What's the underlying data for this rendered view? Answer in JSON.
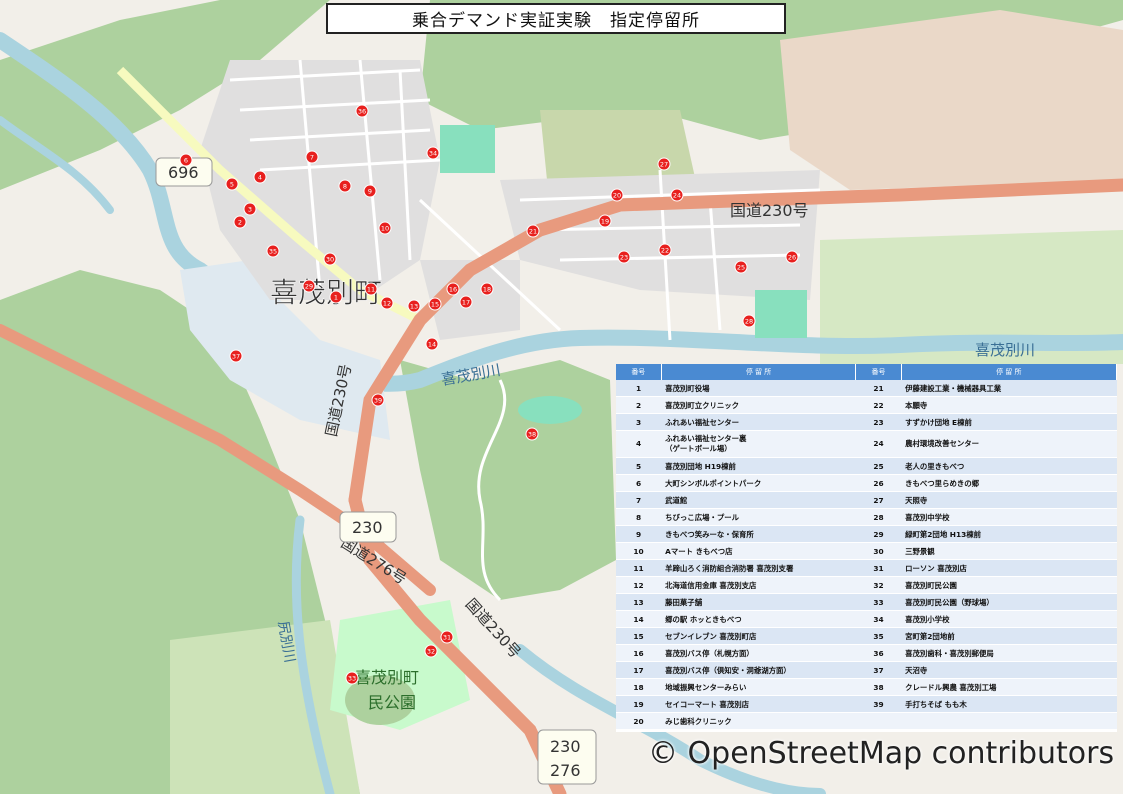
{
  "title": "乗合デマンド実証実験　指定停留所",
  "attribution": "© OpenStreetMap contributors",
  "map_labels": {
    "town": "喜茂別町",
    "route230_a": "国道230号",
    "route230_b": "国道230号",
    "route230_c": "国道230号",
    "route276": "国道276号",
    "river_a": "喜茂別川",
    "river_b": "喜茂別川",
    "river_c": "尻別川",
    "park_line1": "喜茂別町",
    "park_line2": "民公園",
    "shield_696": "696",
    "shield_230a": "230",
    "shield_230b": "230",
    "shield_276": "276"
  },
  "legend": {
    "header_no": "番号",
    "header_name": "停 留 所",
    "rows": [
      {
        "no_a": "1",
        "name_a": "喜茂別町役場",
        "no_b": "21",
        "name_b": "伊藤建設工業・機械器具工業"
      },
      {
        "no_a": "2",
        "name_a": "喜茂別町立クリニック",
        "no_b": "22",
        "name_b": "本願寺"
      },
      {
        "no_a": "3",
        "name_a": "ふれあい福祉センター",
        "no_b": "23",
        "name_b": "すずかけ団地 E棟前"
      },
      {
        "no_a": "4",
        "name_a": "ふれあい福祉センター裏\n（ゲートボール場）",
        "no_b": "24",
        "name_b": "農村環境改善センター"
      },
      {
        "no_a": "5",
        "name_a": "喜茂別団地 H19棟前",
        "no_b": "25",
        "name_b": "老人の里きもべつ"
      },
      {
        "no_a": "6",
        "name_a": "大町シンボルポイントパーク",
        "no_b": "26",
        "name_b": "きもべつ里らめきの郷"
      },
      {
        "no_a": "7",
        "name_a": "武道館",
        "no_b": "27",
        "name_b": "天照寺"
      },
      {
        "no_a": "8",
        "name_a": "ちびっこ広場・プール",
        "no_b": "28",
        "name_b": "喜茂別中学校"
      },
      {
        "no_a": "9",
        "name_a": "きもべつ笑みーな・保育所",
        "no_b": "29",
        "name_b": "緑町第2団地 H13棟前"
      },
      {
        "no_a": "10",
        "name_a": "Aマート きもべつ店",
        "no_b": "30",
        "name_b": "三野景観"
      },
      {
        "no_a": "11",
        "name_a": "羊蹄山ろく消防組合消防署 喜茂別支署",
        "no_b": "31",
        "name_b": "ローソン 喜茂別店"
      },
      {
        "no_a": "12",
        "name_a": "北海道信用金庫 喜茂別支店",
        "no_b": "32",
        "name_b": "喜茂別町民公園"
      },
      {
        "no_a": "13",
        "name_a": "藤田菓子舗",
        "no_b": "33",
        "name_b": "喜茂別町民公園（野球場）"
      },
      {
        "no_a": "14",
        "name_a": "郷の駅 ホッときもべつ",
        "no_b": "34",
        "name_b": "喜茂別小学校"
      },
      {
        "no_a": "15",
        "name_a": "セブンイレブン 喜茂別町店",
        "no_b": "35",
        "name_b": "宮町第2団地前"
      },
      {
        "no_a": "16",
        "name_a": "喜茂別バス停（札幌方面）",
        "no_b": "36",
        "name_b": "喜茂別歯科・喜茂別郵便局"
      },
      {
        "no_a": "17",
        "name_a": "喜茂別バス停（倶知安・洞爺湖方面）",
        "no_b": "37",
        "name_b": "天沼寺"
      },
      {
        "no_a": "18",
        "name_a": "地域振興センターみらい",
        "no_b": "38",
        "name_b": "クレードル興農 喜茂別工場"
      },
      {
        "no_a": "19",
        "name_a": "セイコーマート 喜茂別店",
        "no_b": "39",
        "name_b": "手打ちそば もも木"
      },
      {
        "no_a": "20",
        "name_a": "みじ歯科クリニック",
        "no_b": "",
        "name_b": ""
      }
    ]
  },
  "stops": [
    "1",
    "2",
    "3",
    "4",
    "5",
    "6",
    "7",
    "8",
    "9",
    "10",
    "11",
    "12",
    "13",
    "14",
    "15",
    "16",
    "17",
    "18",
    "19",
    "20",
    "21",
    "22",
    "23",
    "24",
    "25",
    "26",
    "27",
    "28",
    "29",
    "30",
    "31",
    "32",
    "33",
    "34",
    "35",
    "36",
    "37",
    "38",
    "39"
  ],
  "colors": {
    "marker": "#e8201e",
    "route_primary": "#e89a7e",
    "water": "#aad3df",
    "forest": "#add19e",
    "park": "#c8facc",
    "pitch": "#88e0be",
    "legend_header": "#4a8ad2"
  }
}
